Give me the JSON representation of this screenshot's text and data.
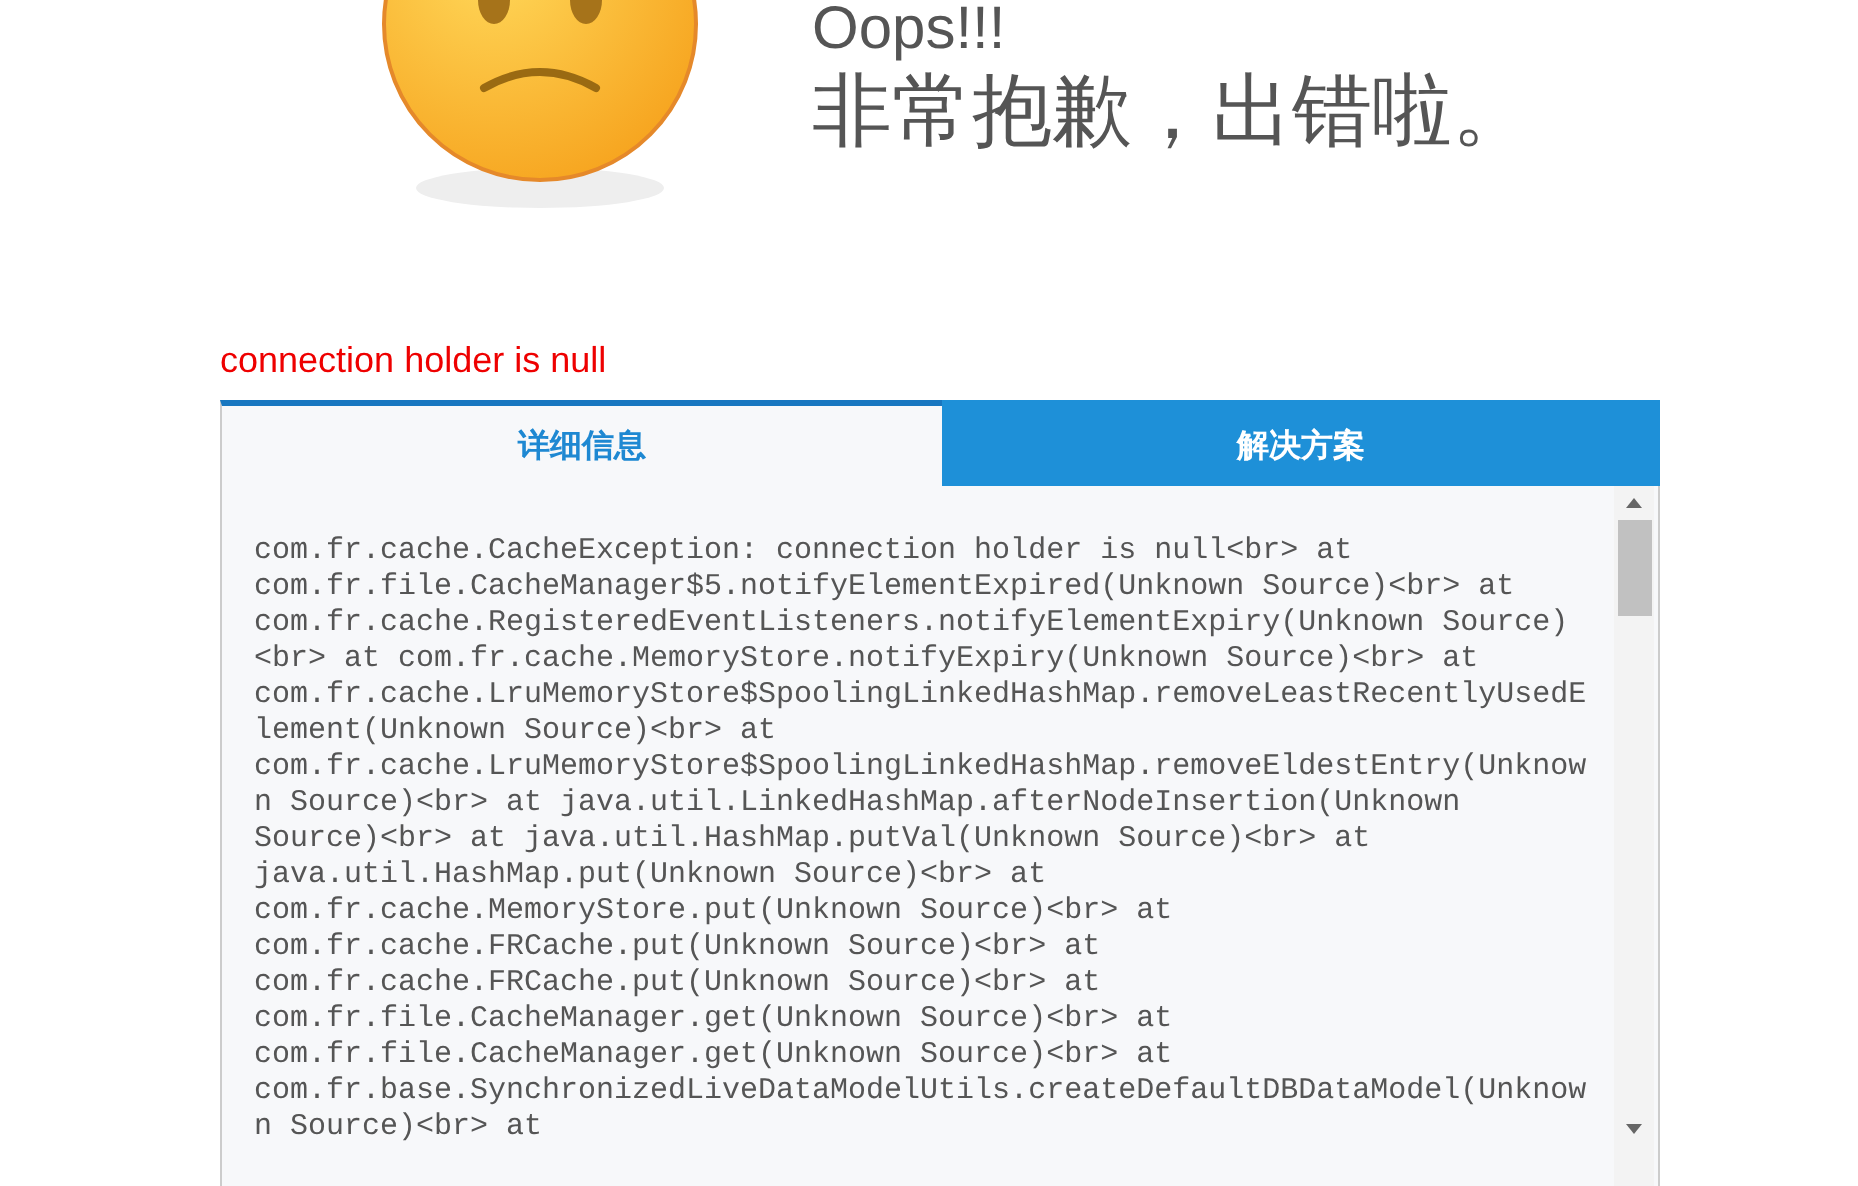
{
  "header": {
    "title": "Oops!!!",
    "subtitle": "非常抱歉，出错啦。"
  },
  "error_message": "connection holder is null",
  "tabs": [
    {
      "label": "详细信息",
      "selected": true
    },
    {
      "label": "解决方案",
      "selected": false
    }
  ],
  "details": {
    "lines": [
      "com.fr.cache.CacheException: connection holder is null<br> at",
      "com.fr.file.CacheManager$5.notifyElementExpired(Unknown Source)<br> at",
      "com.fr.cache.RegisteredEventListeners.notifyElementExpiry(Unknown Source)",
      "<br> at com.fr.cache.MemoryStore.notifyExpiry(Unknown Source)<br> at",
      "com.fr.cache.LruMemoryStore$SpoolingLinkedHashMap.removeLeastRecentlyUsedE",
      "lement(Unknown Source)<br> at",
      "com.fr.cache.LruMemoryStore$SpoolingLinkedHashMap.removeEldestEntry(Unknow",
      "n Source)<br> at java.util.LinkedHashMap.afterNodeInsertion(Unknown",
      "Source)<br> at java.util.HashMap.putVal(Unknown Source)<br> at",
      "java.util.HashMap.put(Unknown Source)<br> at",
      "com.fr.cache.MemoryStore.put(Unknown Source)<br> at",
      "com.fr.cache.FRCache.put(Unknown Source)<br> at",
      "com.fr.cache.FRCache.put(Unknown Source)<br> at",
      "com.fr.file.CacheManager.get(Unknown Source)<br> at",
      "com.fr.file.CacheManager.get(Unknown Source)<br> at",
      "com.fr.base.SynchronizedLiveDataModelUtils.createDefaultDBDataModel(Unknow",
      "n Source)<br> at"
    ]
  }
}
